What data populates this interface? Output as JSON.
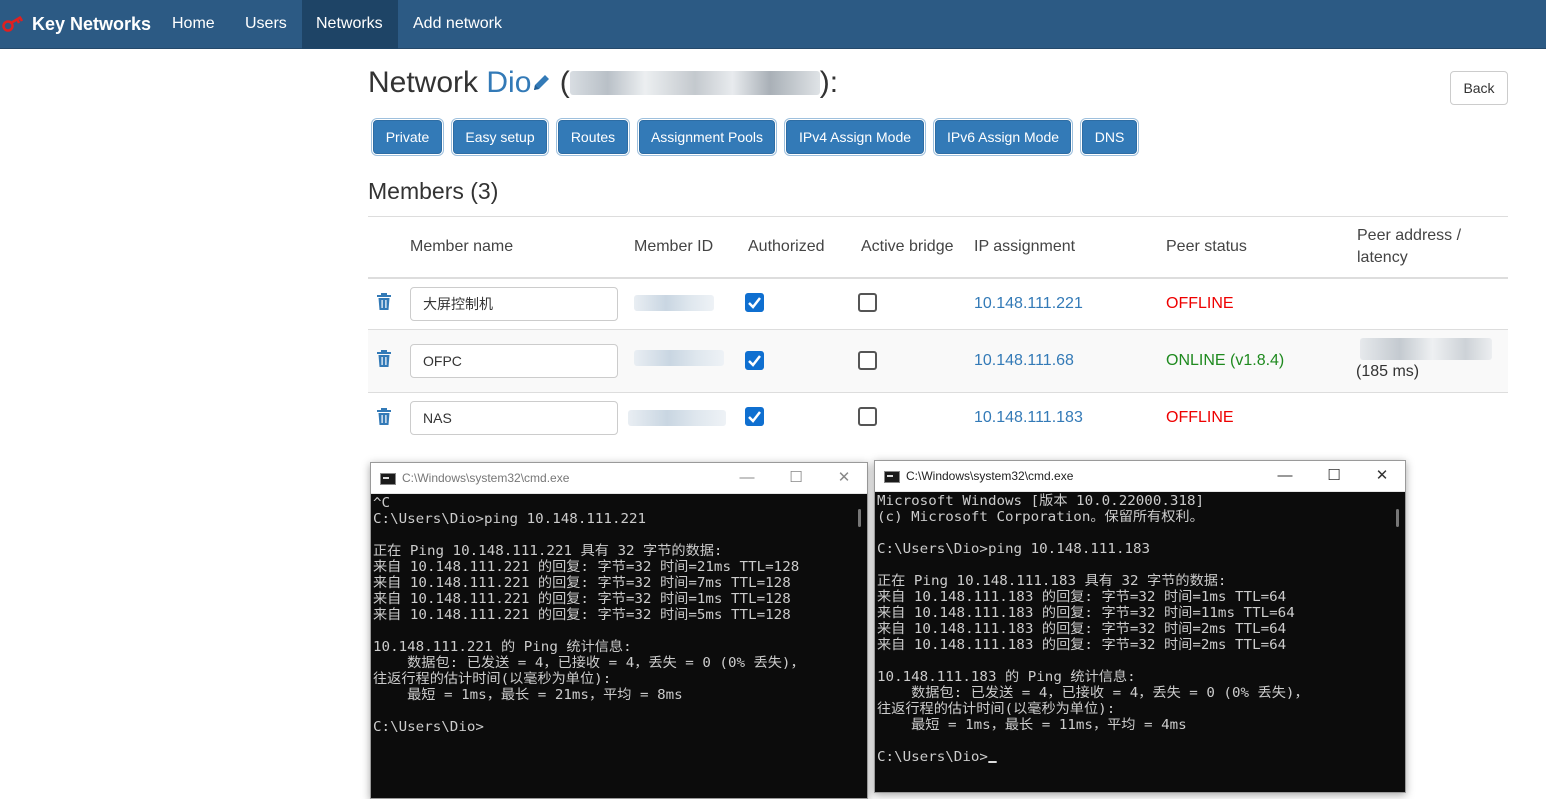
{
  "navbar": {
    "brand": "Key Networks",
    "items": [
      {
        "label": "Home",
        "active": false
      },
      {
        "label": "Users",
        "active": false
      },
      {
        "label": "Networks",
        "active": true
      },
      {
        "label": "Add network",
        "active": false
      }
    ]
  },
  "header": {
    "prefix": "Network ",
    "network_name": "Dio",
    "paren_open": " (",
    "paren_close": "):",
    "back_label": "Back"
  },
  "toolbar": {
    "buttons": [
      "Private",
      "Easy setup",
      "Routes",
      "Assignment Pools",
      "IPv4 Assign Mode",
      "IPv6 Assign Mode",
      "DNS"
    ]
  },
  "members": {
    "title": "Members (3)",
    "columns": [
      "Member name",
      "Member ID",
      "Authorized",
      "Active bridge",
      "IP assignment",
      "Peer status",
      "Peer address /",
      "latency"
    ],
    "rows": [
      {
        "name": "大屏控制机",
        "authorized": true,
        "active_bridge": false,
        "ip": "10.148.111.221",
        "status": "OFFLINE",
        "latency": ""
      },
      {
        "name": "OFPC",
        "authorized": true,
        "active_bridge": false,
        "ip": "10.148.111.68",
        "status": "ONLINE (v1.8.4)",
        "latency": "(185 ms)"
      },
      {
        "name": "NAS",
        "authorized": true,
        "active_bridge": false,
        "ip": "10.148.111.183",
        "status": "OFFLINE",
        "latency": ""
      }
    ]
  },
  "cmd_left": {
    "title": "C:\\Windows\\system32\\cmd.exe",
    "text": "^C\nC:\\Users\\Dio>ping 10.148.111.221\n\n正在 Ping 10.148.111.221 具有 32 字节的数据:\n来自 10.148.111.221 的回复: 字节=32 时间=21ms TTL=128\n来自 10.148.111.221 的回复: 字节=32 时间=7ms TTL=128\n来自 10.148.111.221 的回复: 字节=32 时间=1ms TTL=128\n来自 10.148.111.221 的回复: 字节=32 时间=5ms TTL=128\n\n10.148.111.221 的 Ping 统计信息:\n    数据包: 已发送 = 4，已接收 = 4，丢失 = 0 (0% 丢失)，\n往返行程的估计时间(以毫秒为单位):\n    最短 = 1ms，最长 = 21ms，平均 = 8ms\n\nC:\\Users\\Dio>"
  },
  "cmd_right": {
    "title": "C:\\Windows\\system32\\cmd.exe",
    "text": "Microsoft Windows [版本 10.0.22000.318]\n(c) Microsoft Corporation。保留所有权利。\n\nC:\\Users\\Dio>ping 10.148.111.183\n\n正在 Ping 10.148.111.183 具有 32 字节的数据:\n来自 10.148.111.183 的回复: 字节=32 时间=1ms TTL=64\n来自 10.148.111.183 的回复: 字节=32 时间=11ms TTL=64\n来自 10.148.111.183 的回复: 字节=32 时间=2ms TTL=64\n来自 10.148.111.183 的回复: 字节=32 时间=2ms TTL=64\n\n10.148.111.183 的 Ping 统计信息:\n    数据包: 已发送 = 4，已接收 = 4，丢失 = 0 (0% 丢失)，\n往返行程的估计时间(以毫秒为单位):\n    最短 = 1ms，最长 = 11ms，平均 = 4ms\n\nC:\\Users\\Dio>"
  },
  "colors": {
    "navbar": "#2c5a84",
    "primary": "#337ab7",
    "offline": "#e00000",
    "online": "#1f8a1f",
    "console_bg": "#0c0c0c"
  }
}
